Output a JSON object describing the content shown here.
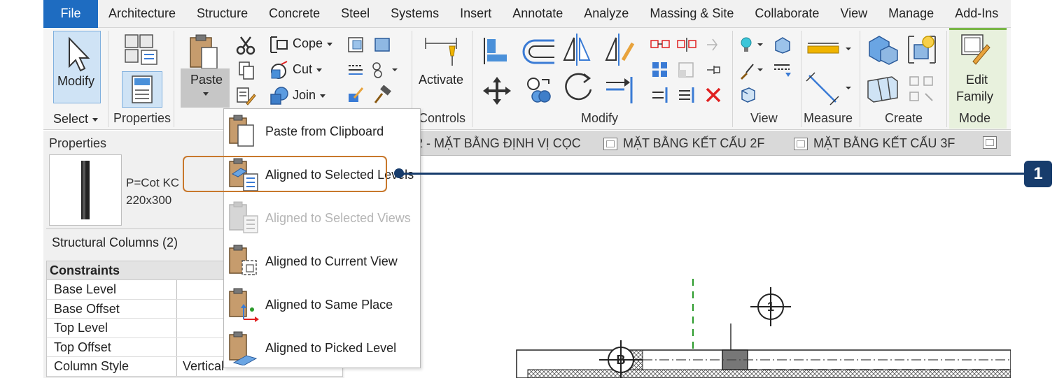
{
  "menu": {
    "file": "File",
    "tabs": [
      "Architecture",
      "Structure",
      "Concrete",
      "Steel",
      "Systems",
      "Insert",
      "Annotate",
      "Analyze",
      "Massing & Site",
      "Collaborate",
      "View",
      "Manage",
      "Add-Ins"
    ]
  },
  "ribbon": {
    "modify_label": "Modify",
    "select_label": "Select",
    "properties_label": "Properties",
    "paste_label": "Paste",
    "cope_label": "Cope",
    "cut_label": "Cut",
    "join_label": "Join",
    "activate_label": "Activate",
    "controls_label": "Controls",
    "modify_group_label": "Modify",
    "view_label": "View",
    "measure_label": "Measure",
    "create_label": "Create",
    "edit_family_line1": "Edit",
    "edit_family_line2": "Family",
    "mode_label": "Mode"
  },
  "doc_tabs": [
    "KC-01.2 - MẶT BẰNG ĐỊNH VỊ CỌC",
    "MẶT BẰNG KẾT CẤU 2F",
    "MẶT BẰNG KẾT CẤU 3F"
  ],
  "properties": {
    "title": "Properties",
    "type_line1": "P=Cot KC",
    "type_line2": "220x300",
    "count": "Structural Columns (2)",
    "section": "Constraints",
    "rows": [
      {
        "key": "Base Level",
        "value": ""
      },
      {
        "key": "Base Offset",
        "value": ""
      },
      {
        "key": "Top Level",
        "value": ""
      },
      {
        "key": "Top Offset",
        "value": ""
      },
      {
        "key": "Column Style",
        "value": "Vertical"
      }
    ]
  },
  "paste_menu": {
    "items": [
      {
        "label": "Paste from Clipboard",
        "enabled": true
      },
      {
        "label": "Aligned to Selected Levels",
        "enabled": true
      },
      {
        "label": "Aligned to Selected Views",
        "enabled": false
      },
      {
        "label": "Aligned to Current View",
        "enabled": true
      },
      {
        "label": "Aligned to Same Place",
        "enabled": true
      },
      {
        "label": "Aligned to Picked Level",
        "enabled": true
      }
    ]
  },
  "drawing": {
    "grid_1": "1",
    "grid_b": "B"
  },
  "callout": {
    "number": "1"
  },
  "colors": {
    "file_tab": "#1e6cc1",
    "highlight": "#c8782c",
    "callout": "#173c6c",
    "delete_red": "#e02020"
  }
}
